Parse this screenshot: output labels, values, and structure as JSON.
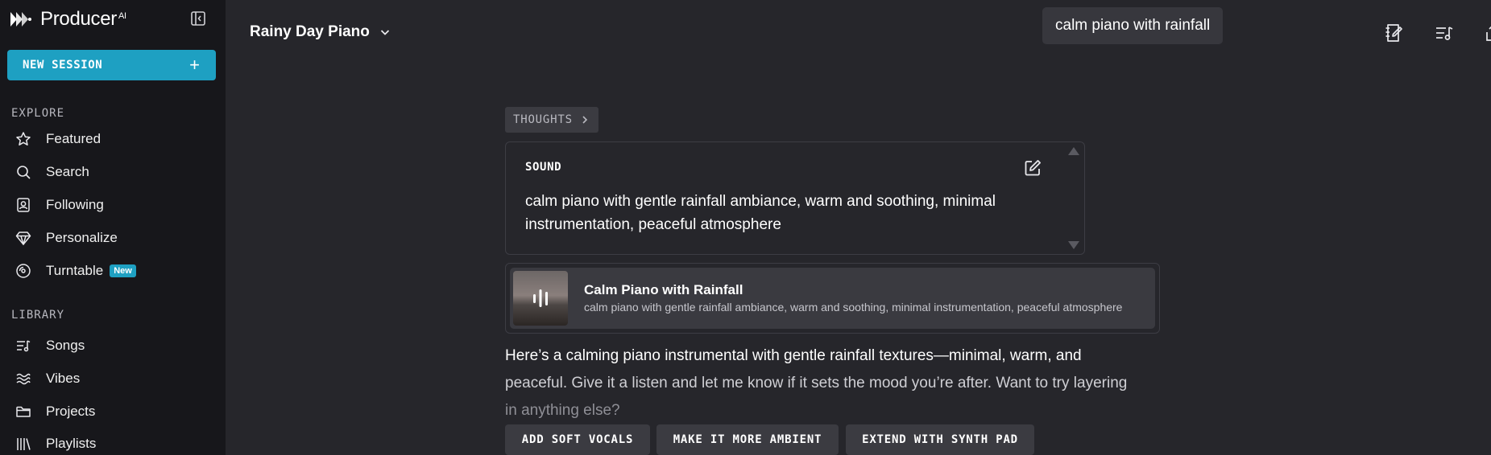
{
  "sidebar": {
    "brand": "Producer",
    "brand_sup": "AI",
    "new_session": "NEW SESSION",
    "explore_label": "EXPLORE",
    "explore": [
      {
        "label": "Featured",
        "icon": "star-icon"
      },
      {
        "label": "Search",
        "icon": "search-icon"
      },
      {
        "label": "Following",
        "icon": "following-icon"
      },
      {
        "label": "Personalize",
        "icon": "diamond-icon"
      },
      {
        "label": "Turntable",
        "icon": "disc-icon",
        "badge": "New"
      }
    ],
    "library_label": "LIBRARY",
    "library": [
      {
        "label": "Songs",
        "icon": "songs-icon"
      },
      {
        "label": "Vibes",
        "icon": "waves-icon"
      },
      {
        "label": "Projects",
        "icon": "folder-icon"
      },
      {
        "label": "Playlists",
        "icon": "playlists-icon"
      }
    ]
  },
  "header": {
    "project_title": "Rainy Day Piano",
    "tooltip": "calm piano with rainfall"
  },
  "chat": {
    "thoughts_label": "THOUGHTS",
    "sound_heading": "SOUND",
    "sound_description": "calm piano with gentle rainfall ambiance, warm and soothing, minimal instrumentation, peaceful atmosphere",
    "song": {
      "title": "Calm Piano with Rainfall",
      "description": "calm piano with gentle rainfall ambiance, warm and soothing, minimal instrumentation, peaceful atmosphere"
    },
    "reply_line1": "Here’s a calming piano instrumental with gentle rainfall textures—minimal, warm, and",
    "reply_line2": "peaceful. Give it a listen and let me know if it sets the mood you’re after. Want to try layering",
    "reply_line3": "in anything else?",
    "suggestions": [
      "ADD SOFT VOCALS",
      "MAKE IT MORE AMBIENT",
      "EXTEND WITH SYNTH PAD"
    ]
  },
  "colors": {
    "accent": "#1ea0c2",
    "sidebar_bg": "#17171b",
    "main_bg": "#26262b"
  }
}
